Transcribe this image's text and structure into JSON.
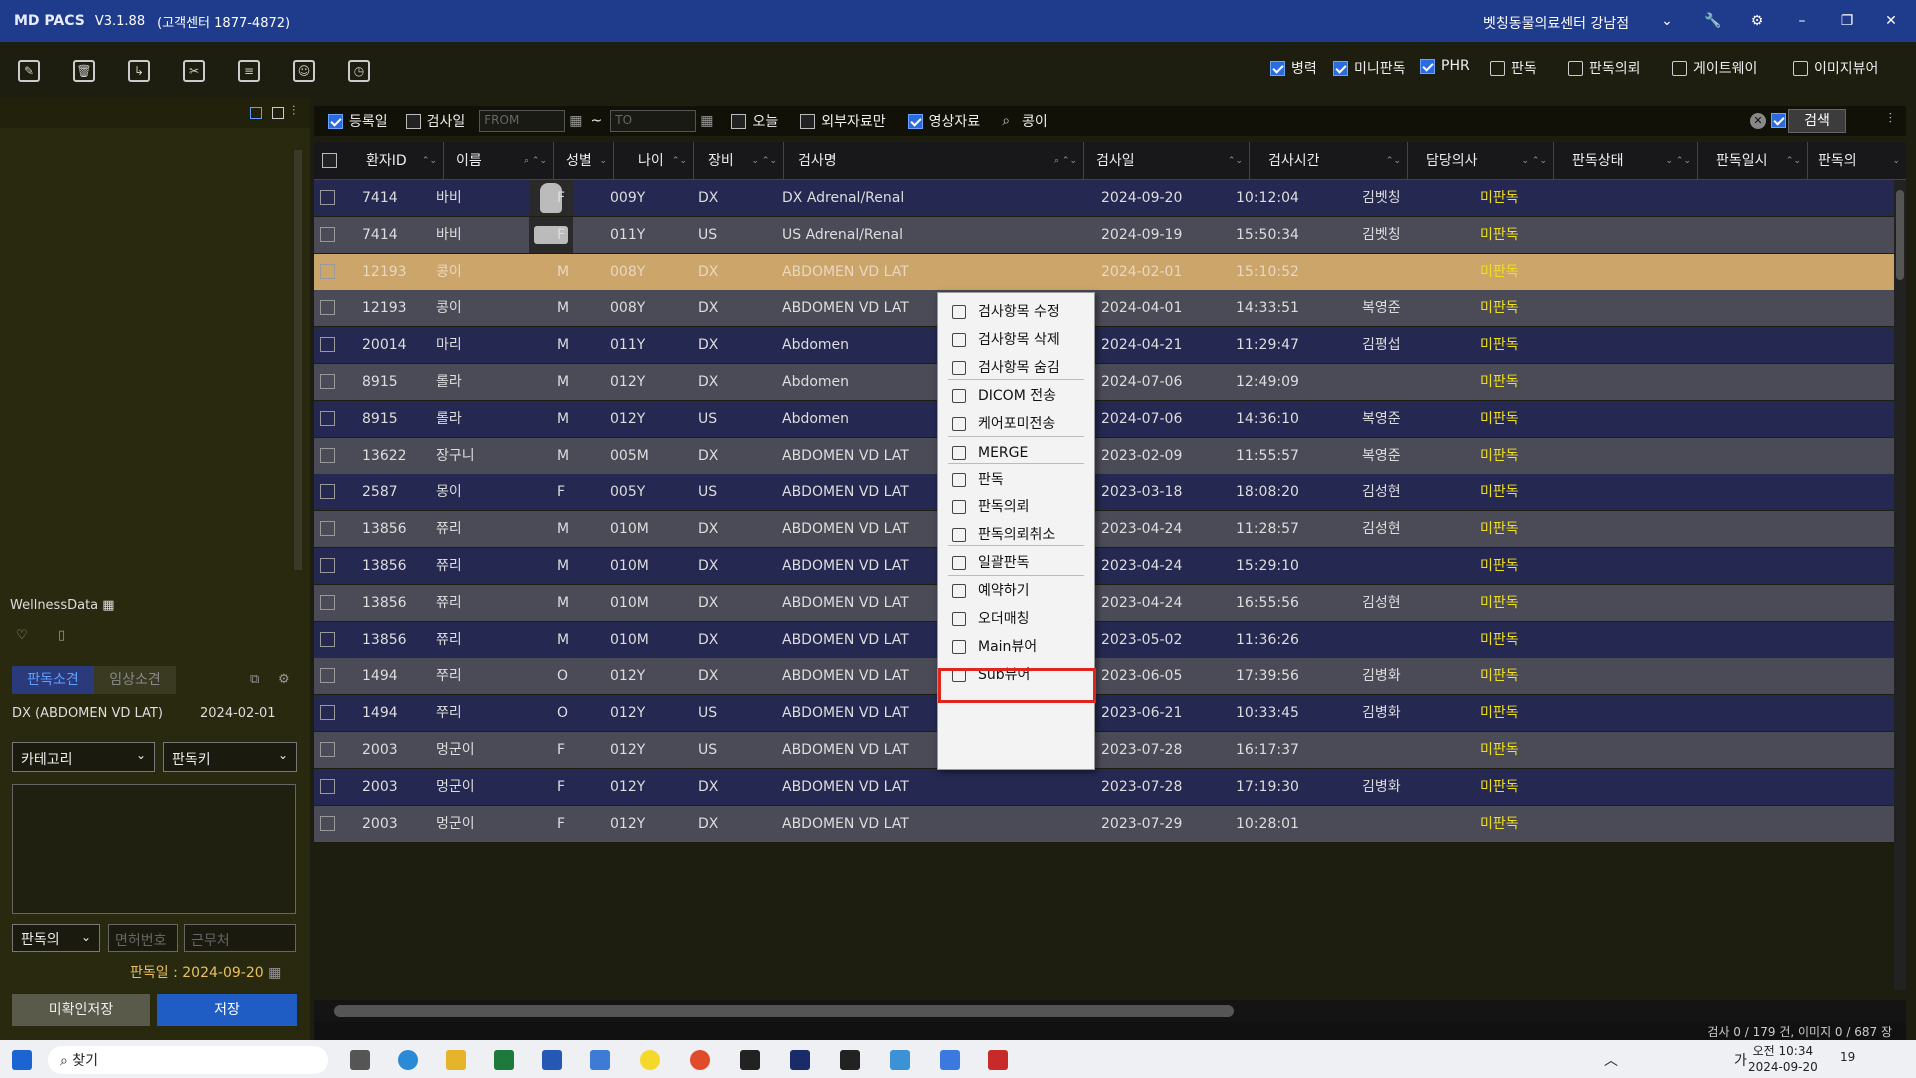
{
  "app": {
    "brand": "MD PACS",
    "version": "V3.1.88",
    "support": "(고객센터 1877-4872)",
    "hospital": "벳칭동물의료센터 강남점"
  },
  "window_controls": [
    "wrench-icon",
    "gear-icon",
    "minimize-icon",
    "restore-icon",
    "close-icon"
  ],
  "toolbar": {
    "left_icons": [
      "edit-icon",
      "delete-icon",
      "import-icon",
      "tools-icon",
      "document-icon",
      "user-icon",
      "history-icon"
    ],
    "right": {
      "byeongryeok": "병력",
      "mini_read": "미니판독",
      "phr": "PHR",
      "read": "판독",
      "read_request": "판독의뢰",
      "gateway": "게이트웨이",
      "image_viewer": "이미지뷰어"
    }
  },
  "filter": {
    "reg_date": "등록일",
    "exam_date": "검사일",
    "from_placeholder": "FROM",
    "tilde": "~",
    "to_placeholder": "TO",
    "today": "오늘",
    "external_only": "외부자료만",
    "image_data": "영상자료",
    "search_value": "콩이",
    "search_button": "검색"
  },
  "columns": {
    "patient_id": "환자ID",
    "name": "이름",
    "sex": "성별",
    "age": "나이",
    "modality": "장비",
    "exam_name": "검사명",
    "exam_date": "검사일",
    "exam_time": "검사시간",
    "doctor": "담당의사",
    "read_status": "판독상태",
    "read_datetime": "판독일시",
    "reader": "판독의"
  },
  "rows": [
    {
      "id": "7414",
      "name": "바비",
      "sex": "F",
      "age": "009Y",
      "mod": "DX",
      "exam": "DX Adrenal/Renal",
      "date": "2024-09-20",
      "time": "10:12:04",
      "doctor": "김벳칭",
      "status": "미판독"
    },
    {
      "id": "7414",
      "name": "바비",
      "sex": "F",
      "age": "011Y",
      "mod": "US",
      "exam": "US Adrenal/Renal",
      "date": "2024-09-19",
      "time": "15:50:34",
      "doctor": "김벳칭",
      "status": "미판독"
    },
    {
      "id": "12193",
      "name": "콩이",
      "sex": "M",
      "age": "008Y",
      "mod": "DX",
      "exam": "ABDOMEN VD LAT",
      "date": "2024-02-01",
      "time": "15:10:52",
      "doctor": "",
      "status": "미판독"
    },
    {
      "id": "12193",
      "name": "콩이",
      "sex": "M",
      "age": "008Y",
      "mod": "DX",
      "exam": "ABDOMEN VD LAT",
      "date": "2024-04-01",
      "time": "14:33:51",
      "doctor": "복영준",
      "status": "미판독"
    },
    {
      "id": "20014",
      "name": "마리",
      "sex": "M",
      "age": "011Y",
      "mod": "DX",
      "exam": "Abdomen",
      "date": "2024-04-21",
      "time": "11:29:47",
      "doctor": "김평섭",
      "status": "미판독"
    },
    {
      "id": "8915",
      "name": "롤라",
      "sex": "M",
      "age": "012Y",
      "mod": "DX",
      "exam": "Abdomen",
      "date": "2024-07-06",
      "time": "12:49:09",
      "doctor": "",
      "status": "미판독"
    },
    {
      "id": "8915",
      "name": "롤라",
      "sex": "M",
      "age": "012Y",
      "mod": "US",
      "exam": "Abdomen",
      "date": "2024-07-06",
      "time": "14:36:10",
      "doctor": "복영준",
      "status": "미판독"
    },
    {
      "id": "13622",
      "name": "장구니",
      "sex": "M",
      "age": "005M",
      "mod": "DX",
      "exam": "ABDOMEN VD LAT",
      "date": "2023-02-09",
      "time": "11:55:57",
      "doctor": "복영준",
      "status": "미판독"
    },
    {
      "id": "2587",
      "name": "몽이",
      "sex": "F",
      "age": "005Y",
      "mod": "US",
      "exam": "ABDOMEN VD LAT",
      "date": "2023-03-18",
      "time": "18:08:20",
      "doctor": "김성현",
      "status": "미판독"
    },
    {
      "id": "13856",
      "name": "쮸리",
      "sex": "M",
      "age": "010M",
      "mod": "DX",
      "exam": "ABDOMEN VD LAT",
      "date": "2023-04-24",
      "time": "11:28:57",
      "doctor": "김성현",
      "status": "미판독"
    },
    {
      "id": "13856",
      "name": "쮸리",
      "sex": "M",
      "age": "010M",
      "mod": "DX",
      "exam": "ABDOMEN VD LAT",
      "date": "2023-04-24",
      "time": "15:29:10",
      "doctor": "",
      "status": "미판독"
    },
    {
      "id": "13856",
      "name": "쮸리",
      "sex": "M",
      "age": "010M",
      "mod": "DX",
      "exam": "ABDOMEN VD LAT",
      "date": "2023-04-24",
      "time": "16:55:56",
      "doctor": "김성현",
      "status": "미판독"
    },
    {
      "id": "13856",
      "name": "쮸리",
      "sex": "M",
      "age": "010M",
      "mod": "DX",
      "exam": "ABDOMEN VD LAT",
      "date": "2023-05-02",
      "time": "11:36:26",
      "doctor": "",
      "status": "미판독"
    },
    {
      "id": "1494",
      "name": "쭈리",
      "sex": "O",
      "age": "012Y",
      "mod": "DX",
      "exam": "ABDOMEN VD LAT",
      "date": "2023-06-05",
      "time": "17:39:56",
      "doctor": "김병화",
      "status": "미판독"
    },
    {
      "id": "1494",
      "name": "쭈리",
      "sex": "O",
      "age": "012Y",
      "mod": "US",
      "exam": "ABDOMEN VD LAT",
      "date": "2023-06-21",
      "time": "10:33:45",
      "doctor": "김병화",
      "status": "미판독"
    },
    {
      "id": "2003",
      "name": "멍군이",
      "sex": "F",
      "age": "012Y",
      "mod": "US",
      "exam": "ABDOMEN VD LAT",
      "date": "2023-07-28",
      "time": "16:17:37",
      "doctor": "",
      "status": "미판독"
    },
    {
      "id": "2003",
      "name": "멍군이",
      "sex": "F",
      "age": "012Y",
      "mod": "DX",
      "exam": "ABDOMEN VD LAT",
      "date": "2023-07-28",
      "time": "17:19:30",
      "doctor": "김병화",
      "status": "미판독"
    },
    {
      "id": "2003",
      "name": "멍군이",
      "sex": "F",
      "age": "012Y",
      "mod": "DX",
      "exam": "ABDOMEN VD LAT",
      "date": "2023-07-29",
      "time": "10:28:01",
      "doctor": "",
      "status": "미판독"
    }
  ],
  "context_menu": [
    "검사항목 수정",
    "검사항목 삭제",
    "검사항목 숨김",
    "DICOM 전송",
    "케어포미전송",
    "MERGE",
    "판독",
    "판독의뢰",
    "판독의뢰취소",
    "일괄판독",
    "예약하기",
    "오더매칭",
    "Main뷰어",
    "Sub뷰어"
  ],
  "left": {
    "wellness": "WellnessData",
    "tab_read": "판독소견",
    "tab_clinical": "임상소견",
    "finding_exam": "DX (ABDOMEN VD LAT)",
    "finding_date": "2024-02-01",
    "category": "카테고리",
    "read_key": "판독키",
    "reader": "판독의",
    "license_placeholder": "면허번호",
    "workplace_placeholder": "근무처",
    "read_date_label": "판독일 :",
    "read_date": "2024-09-20",
    "btn_unconfirmed": "미확인저장",
    "btn_save": "저장"
  },
  "status": "검사 0 / 179 건, 이미지 0 / 687 장",
  "taskbar": {
    "search": "찾기",
    "time": "오전 10:34",
    "date": "2024-09-20",
    "lang": "가",
    "notif": "19"
  },
  "accent": {
    "title": "#1f3b8c",
    "selected_row": "#cba56a",
    "status_yellow": "#f0e020",
    "highlight": "#e0251d"
  }
}
